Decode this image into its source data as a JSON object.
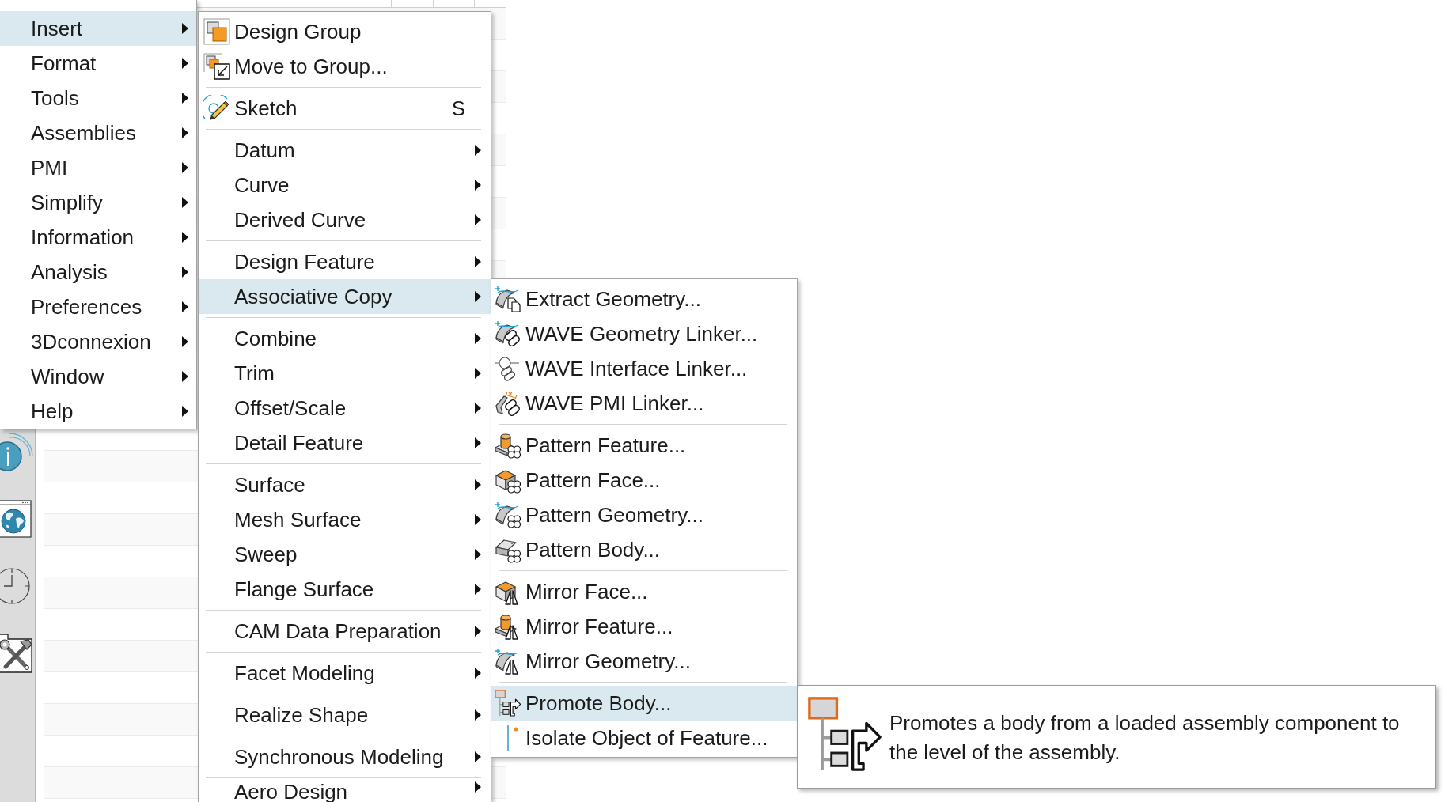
{
  "main_menu": {
    "items": [
      {
        "label": "Insert",
        "submenu": true,
        "selected": true
      },
      {
        "label": "Format",
        "submenu": true,
        "selected": false
      },
      {
        "label": "Tools",
        "submenu": true,
        "selected": false
      },
      {
        "label": "Assemblies",
        "submenu": true,
        "selected": false
      },
      {
        "label": "PMI",
        "submenu": true,
        "selected": false
      },
      {
        "label": "Simplify",
        "submenu": true,
        "selected": false
      },
      {
        "label": "Information",
        "submenu": true,
        "selected": false
      },
      {
        "label": "Analysis",
        "submenu": true,
        "selected": false
      },
      {
        "label": "Preferences",
        "submenu": true,
        "selected": false
      },
      {
        "label": "3Dconnexion",
        "submenu": true,
        "selected": false
      },
      {
        "label": "Window",
        "submenu": true,
        "selected": false
      },
      {
        "label": "Help",
        "submenu": true,
        "selected": false
      }
    ]
  },
  "insert_menu": {
    "groups": [
      [
        {
          "label": "Design Group",
          "submenu": false,
          "selected": false
        },
        {
          "label": "Move to Group...",
          "submenu": false,
          "selected": false
        }
      ],
      [
        {
          "label": "Sketch",
          "shortcut": "S",
          "submenu": false,
          "selected": false
        }
      ],
      [
        {
          "label": "Datum",
          "submenu": true,
          "selected": false
        },
        {
          "label": "Curve",
          "submenu": true,
          "selected": false
        },
        {
          "label": "Derived Curve",
          "submenu": true,
          "selected": false
        }
      ],
      [
        {
          "label": "Design Feature",
          "submenu": true,
          "selected": false
        },
        {
          "label": "Associative Copy",
          "submenu": true,
          "selected": true
        }
      ],
      [
        {
          "label": "Combine",
          "submenu": true,
          "selected": false
        },
        {
          "label": "Trim",
          "submenu": true,
          "selected": false
        },
        {
          "label": "Offset/Scale",
          "submenu": true,
          "selected": false
        },
        {
          "label": "Detail Feature",
          "submenu": true,
          "selected": false
        }
      ],
      [
        {
          "label": "Surface",
          "submenu": true,
          "selected": false
        },
        {
          "label": "Mesh Surface",
          "submenu": true,
          "selected": false
        },
        {
          "label": "Sweep",
          "submenu": true,
          "selected": false
        },
        {
          "label": "Flange Surface",
          "submenu": true,
          "selected": false
        }
      ],
      [
        {
          "label": "CAM Data Preparation",
          "submenu": true,
          "selected": false
        }
      ],
      [
        {
          "label": "Facet Modeling",
          "submenu": true,
          "selected": false
        }
      ],
      [
        {
          "label": "Realize Shape",
          "submenu": true,
          "selected": false
        }
      ],
      [
        {
          "label": "Synchronous Modeling",
          "submenu": true,
          "selected": false
        }
      ],
      [
        {
          "label": "Aero Design",
          "submenu": true,
          "selected": false
        }
      ]
    ]
  },
  "associative_copy_menu": {
    "groups": [
      [
        {
          "label": "Extract Geometry...",
          "selected": false
        },
        {
          "label": "WAVE Geometry Linker...",
          "selected": false
        },
        {
          "label": "WAVE Interface Linker...",
          "selected": false
        },
        {
          "label": "WAVE PMI Linker...",
          "selected": false
        }
      ],
      [
        {
          "label": "Pattern Feature...",
          "selected": false
        },
        {
          "label": "Pattern Face...",
          "selected": false
        },
        {
          "label": "Pattern Geometry...",
          "selected": false
        },
        {
          "label": "Pattern Body...",
          "selected": false
        }
      ],
      [
        {
          "label": "Mirror Face...",
          "selected": false
        },
        {
          "label": "Mirror Feature...",
          "selected": false
        },
        {
          "label": "Mirror Geometry...",
          "selected": false
        }
      ],
      [
        {
          "label": "Promote Body...",
          "selected": true
        },
        {
          "label": "Isolate Object of Feature...",
          "selected": false
        }
      ]
    ]
  },
  "tooltip": {
    "text": "Promotes a body from a loaded assembly component to the level of the assembly."
  }
}
